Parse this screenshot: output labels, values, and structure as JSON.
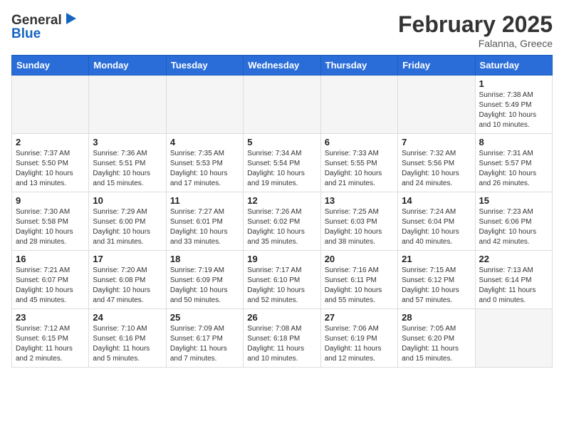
{
  "header": {
    "logo_general": "General",
    "logo_blue": "Blue",
    "month_year": "February 2025",
    "location": "Falanna, Greece"
  },
  "days_of_week": [
    "Sunday",
    "Monday",
    "Tuesday",
    "Wednesday",
    "Thursday",
    "Friday",
    "Saturday"
  ],
  "weeks": [
    [
      {
        "day": "",
        "info": ""
      },
      {
        "day": "",
        "info": ""
      },
      {
        "day": "",
        "info": ""
      },
      {
        "day": "",
        "info": ""
      },
      {
        "day": "",
        "info": ""
      },
      {
        "day": "",
        "info": ""
      },
      {
        "day": "1",
        "info": "Sunrise: 7:38 AM\nSunset: 5:49 PM\nDaylight: 10 hours\nand 10 minutes."
      }
    ],
    [
      {
        "day": "2",
        "info": "Sunrise: 7:37 AM\nSunset: 5:50 PM\nDaylight: 10 hours\nand 13 minutes."
      },
      {
        "day": "3",
        "info": "Sunrise: 7:36 AM\nSunset: 5:51 PM\nDaylight: 10 hours\nand 15 minutes."
      },
      {
        "day": "4",
        "info": "Sunrise: 7:35 AM\nSunset: 5:53 PM\nDaylight: 10 hours\nand 17 minutes."
      },
      {
        "day": "5",
        "info": "Sunrise: 7:34 AM\nSunset: 5:54 PM\nDaylight: 10 hours\nand 19 minutes."
      },
      {
        "day": "6",
        "info": "Sunrise: 7:33 AM\nSunset: 5:55 PM\nDaylight: 10 hours\nand 21 minutes."
      },
      {
        "day": "7",
        "info": "Sunrise: 7:32 AM\nSunset: 5:56 PM\nDaylight: 10 hours\nand 24 minutes."
      },
      {
        "day": "8",
        "info": "Sunrise: 7:31 AM\nSunset: 5:57 PM\nDaylight: 10 hours\nand 26 minutes."
      }
    ],
    [
      {
        "day": "9",
        "info": "Sunrise: 7:30 AM\nSunset: 5:58 PM\nDaylight: 10 hours\nand 28 minutes."
      },
      {
        "day": "10",
        "info": "Sunrise: 7:29 AM\nSunset: 6:00 PM\nDaylight: 10 hours\nand 31 minutes."
      },
      {
        "day": "11",
        "info": "Sunrise: 7:27 AM\nSunset: 6:01 PM\nDaylight: 10 hours\nand 33 minutes."
      },
      {
        "day": "12",
        "info": "Sunrise: 7:26 AM\nSunset: 6:02 PM\nDaylight: 10 hours\nand 35 minutes."
      },
      {
        "day": "13",
        "info": "Sunrise: 7:25 AM\nSunset: 6:03 PM\nDaylight: 10 hours\nand 38 minutes."
      },
      {
        "day": "14",
        "info": "Sunrise: 7:24 AM\nSunset: 6:04 PM\nDaylight: 10 hours\nand 40 minutes."
      },
      {
        "day": "15",
        "info": "Sunrise: 7:23 AM\nSunset: 6:06 PM\nDaylight: 10 hours\nand 42 minutes."
      }
    ],
    [
      {
        "day": "16",
        "info": "Sunrise: 7:21 AM\nSunset: 6:07 PM\nDaylight: 10 hours\nand 45 minutes."
      },
      {
        "day": "17",
        "info": "Sunrise: 7:20 AM\nSunset: 6:08 PM\nDaylight: 10 hours\nand 47 minutes."
      },
      {
        "day": "18",
        "info": "Sunrise: 7:19 AM\nSunset: 6:09 PM\nDaylight: 10 hours\nand 50 minutes."
      },
      {
        "day": "19",
        "info": "Sunrise: 7:17 AM\nSunset: 6:10 PM\nDaylight: 10 hours\nand 52 minutes."
      },
      {
        "day": "20",
        "info": "Sunrise: 7:16 AM\nSunset: 6:11 PM\nDaylight: 10 hours\nand 55 minutes."
      },
      {
        "day": "21",
        "info": "Sunrise: 7:15 AM\nSunset: 6:12 PM\nDaylight: 10 hours\nand 57 minutes."
      },
      {
        "day": "22",
        "info": "Sunrise: 7:13 AM\nSunset: 6:14 PM\nDaylight: 11 hours\nand 0 minutes."
      }
    ],
    [
      {
        "day": "23",
        "info": "Sunrise: 7:12 AM\nSunset: 6:15 PM\nDaylight: 11 hours\nand 2 minutes."
      },
      {
        "day": "24",
        "info": "Sunrise: 7:10 AM\nSunset: 6:16 PM\nDaylight: 11 hours\nand 5 minutes."
      },
      {
        "day": "25",
        "info": "Sunrise: 7:09 AM\nSunset: 6:17 PM\nDaylight: 11 hours\nand 7 minutes."
      },
      {
        "day": "26",
        "info": "Sunrise: 7:08 AM\nSunset: 6:18 PM\nDaylight: 11 hours\nand 10 minutes."
      },
      {
        "day": "27",
        "info": "Sunrise: 7:06 AM\nSunset: 6:19 PM\nDaylight: 11 hours\nand 12 minutes."
      },
      {
        "day": "28",
        "info": "Sunrise: 7:05 AM\nSunset: 6:20 PM\nDaylight: 11 hours\nand 15 minutes."
      },
      {
        "day": "",
        "info": ""
      }
    ]
  ]
}
